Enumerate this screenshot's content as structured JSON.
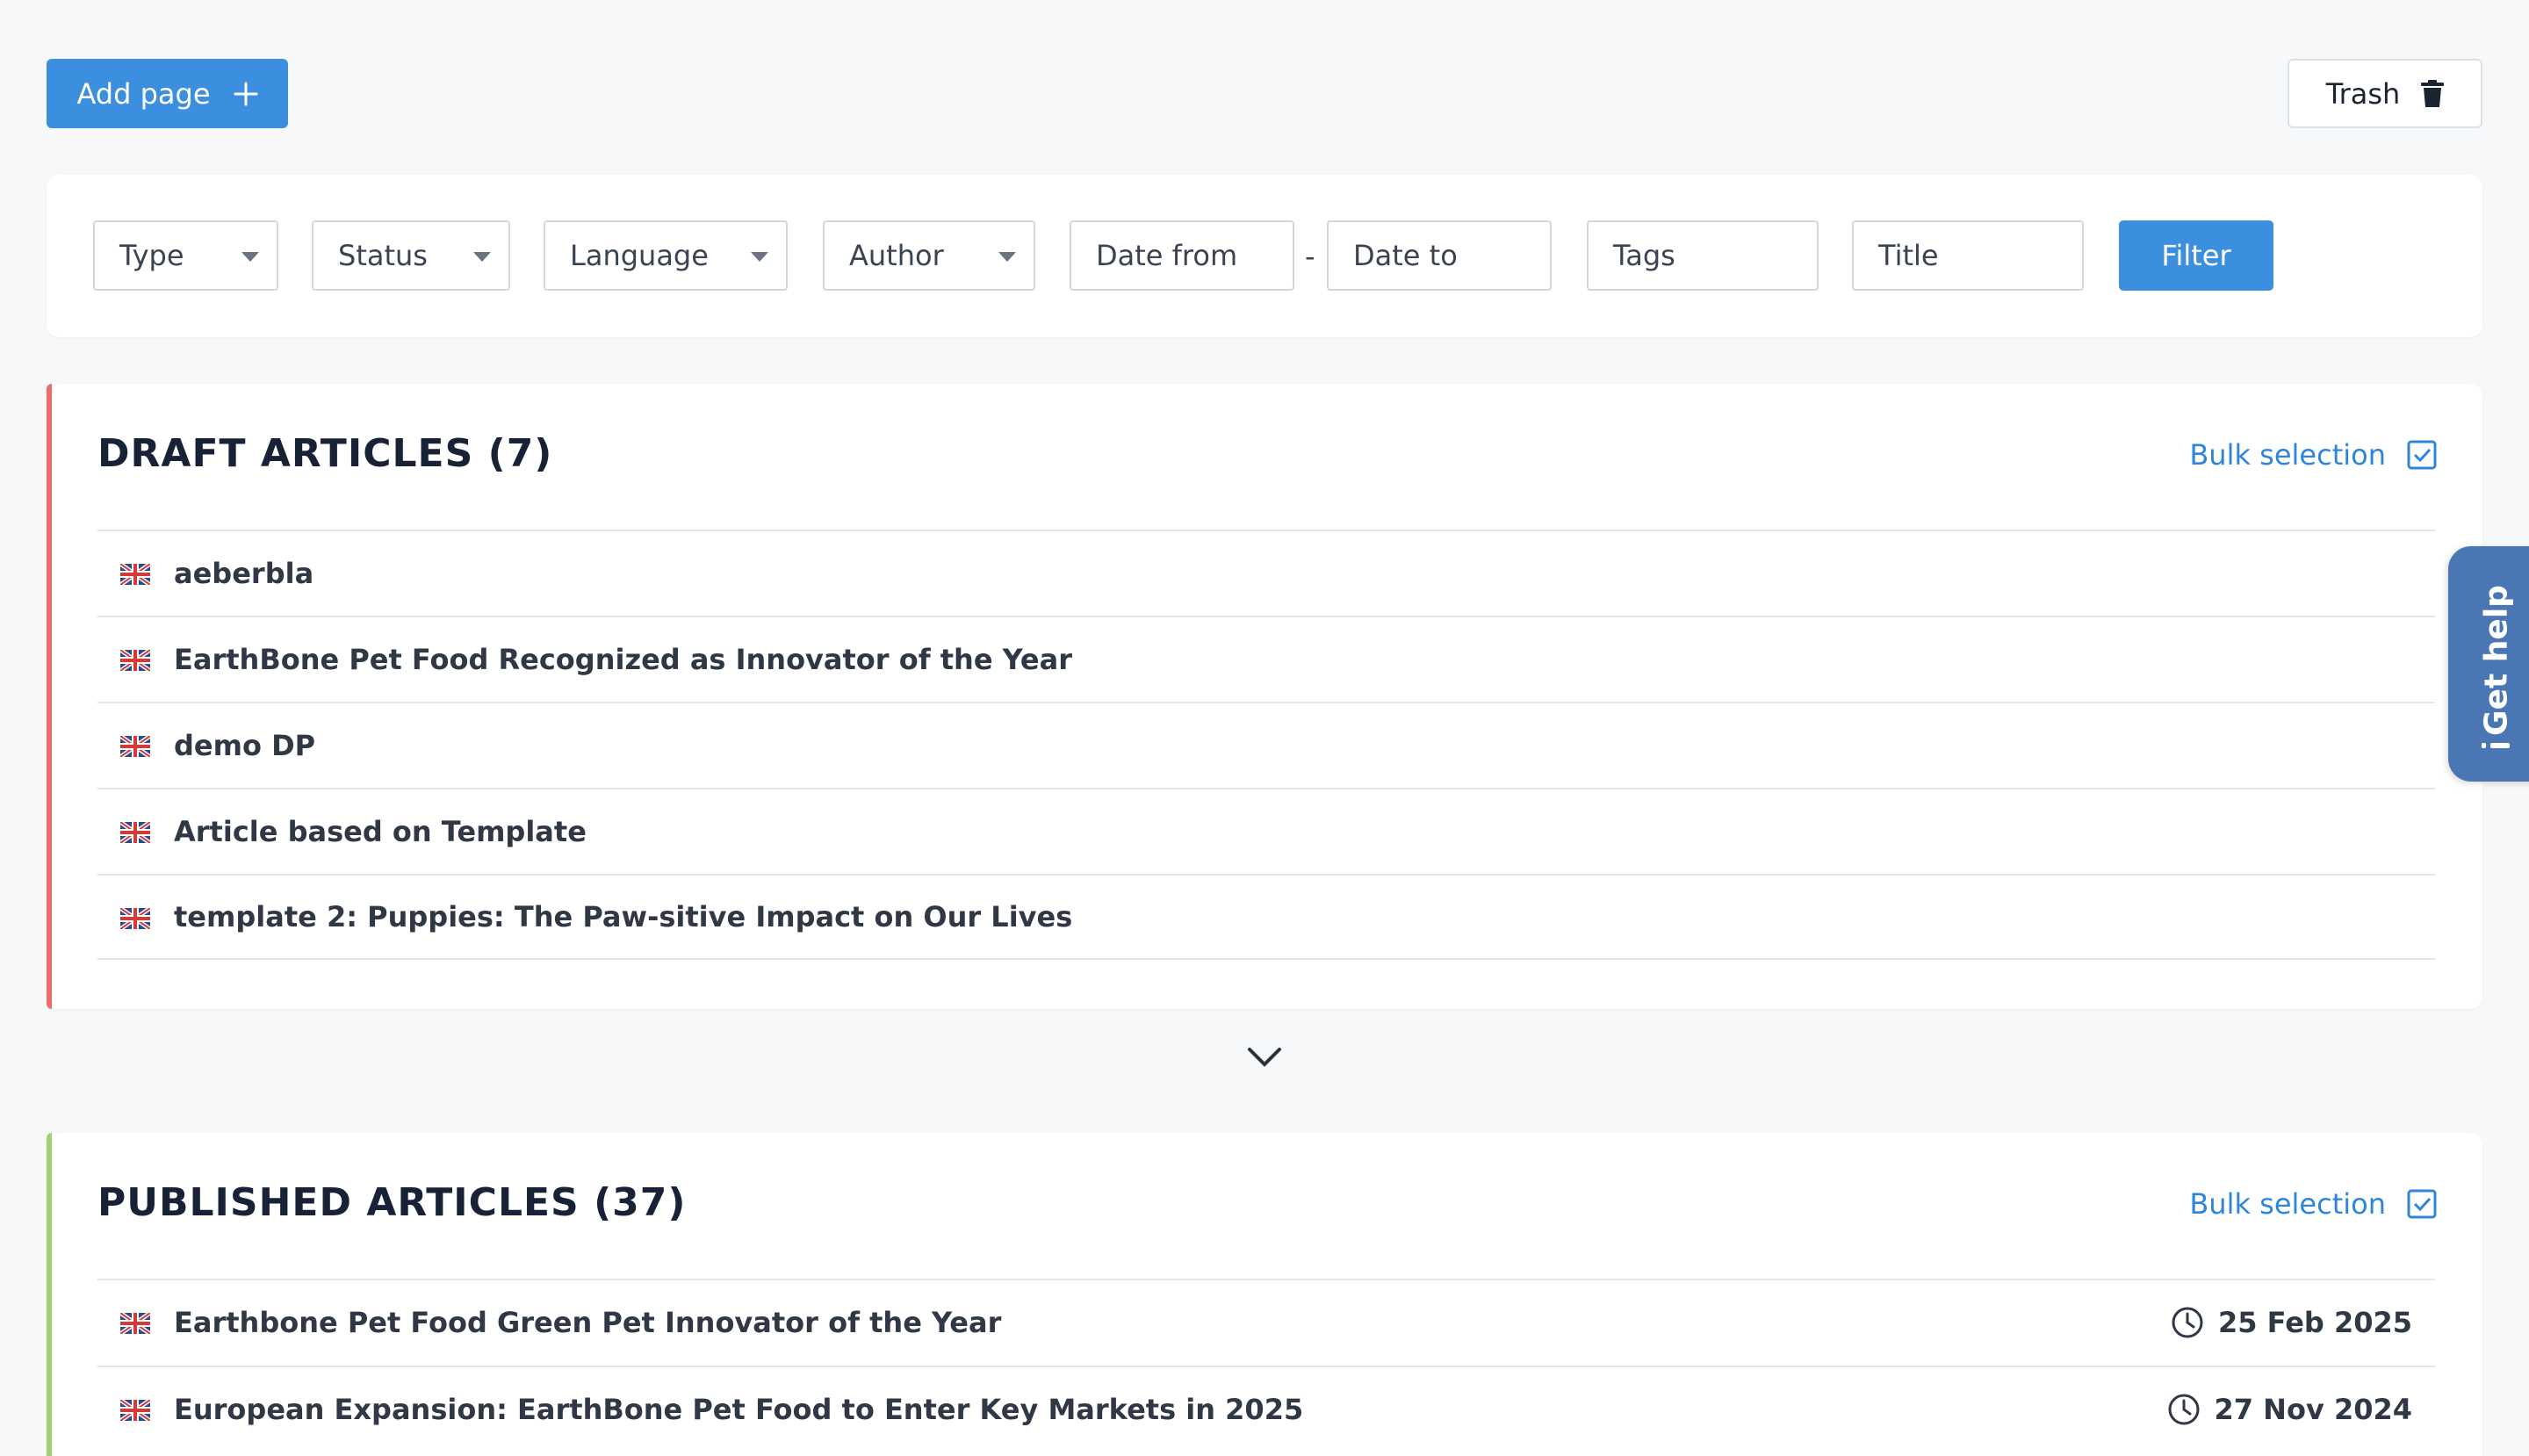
{
  "toolbar": {
    "add_page_label": "Add page",
    "trash_label": "Trash"
  },
  "filters": {
    "type": "Type",
    "status": "Status",
    "language": "Language",
    "author": "Author",
    "date_from": "Date from",
    "date_separator": "-",
    "date_to": "Date to",
    "tags": "Tags",
    "title": "Title",
    "filter_button": "Filter"
  },
  "drafts": {
    "title": "DRAFT ARTICLES (7)",
    "bulk_label": "Bulk selection",
    "accent_color": "#ef6b6b",
    "items": [
      {
        "title": "aeberbla"
      },
      {
        "title": "EarthBone Pet Food Recognized as Innovator of the Year"
      },
      {
        "title": "demo DP"
      },
      {
        "title": "Article based on Template"
      },
      {
        "title": "template 2: Puppies: The Paw-sitive Impact on Our Lives"
      }
    ]
  },
  "published": {
    "title": "PUBLISHED ARTICLES (37)",
    "bulk_label": "Bulk selection",
    "accent_color": "#9ed36f",
    "items": [
      {
        "title": "Earthbone Pet Food Green Pet Innovator of the Year",
        "date": "25 Feb 2025"
      },
      {
        "title": "European Expansion: EarthBone Pet Food to Enter Key Markets in 2025",
        "date": "27 Nov 2024"
      }
    ]
  },
  "help": {
    "label": "Get help"
  },
  "icons": {
    "add": "plus-icon",
    "trash": "trash-icon",
    "bulk": "checkbox-icon",
    "flag": "uk-flag-icon",
    "clock": "clock-icon",
    "expand": "chevron-down-icon",
    "help": "info-icon"
  }
}
